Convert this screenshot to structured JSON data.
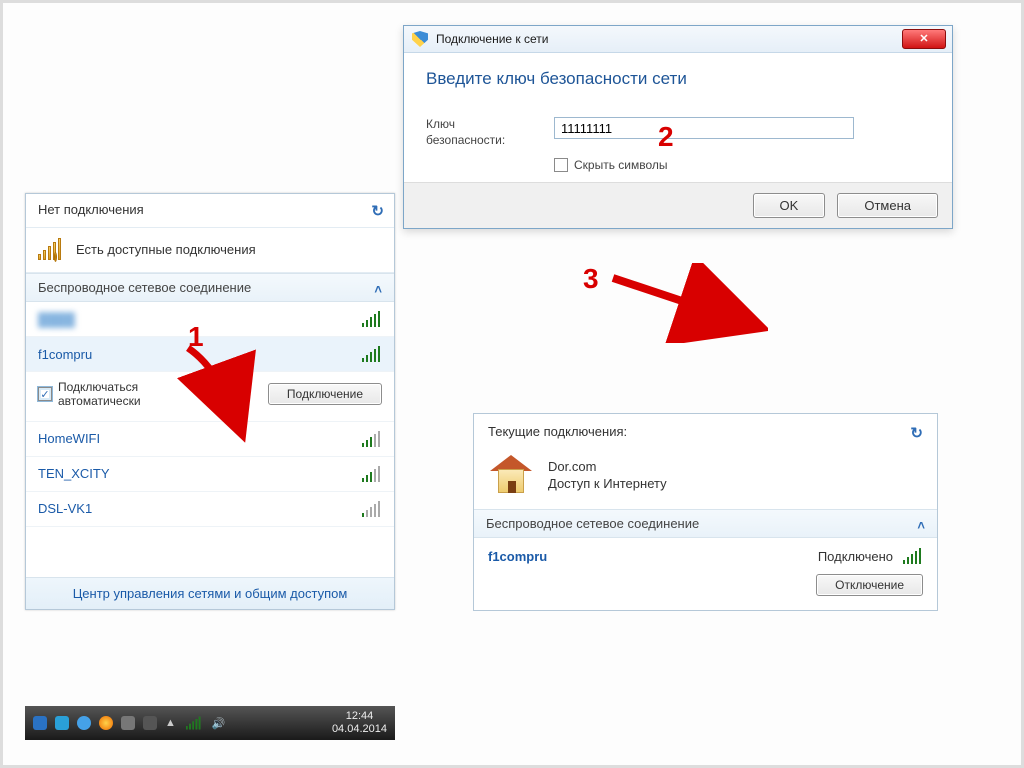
{
  "left": {
    "title": "Нет подключения",
    "status": "Есть доступные подключения",
    "section": "Беспроводное сетевое соединение",
    "autoconnect": "Подключаться автоматически",
    "connect_btn": "Подключение",
    "networks": [
      "f1compru",
      "HomeWIFI",
      "TEN_XCITY",
      "DSL-VK1"
    ],
    "footer": "Центр управления сетями и общим доступом"
  },
  "dialog": {
    "title": "Подключение к сети",
    "heading": "Введите ключ безопасности сети",
    "label": "Ключ безопасности:",
    "value": "11111111",
    "hide": "Скрыть символы",
    "ok": "OK",
    "cancel": "Отмена"
  },
  "right": {
    "title": "Текущие подключения:",
    "netname": "Dor.com",
    "status": "Доступ к Интернету",
    "section": "Беспроводное сетевое соединение",
    "ssid": "f1compru",
    "state": "Подключено",
    "disconnect": "Отключение"
  },
  "clock": {
    "time": "12:44",
    "date": "04.04.2014"
  },
  "anno": {
    "n1": "1",
    "n2": "2",
    "n3": "3"
  }
}
